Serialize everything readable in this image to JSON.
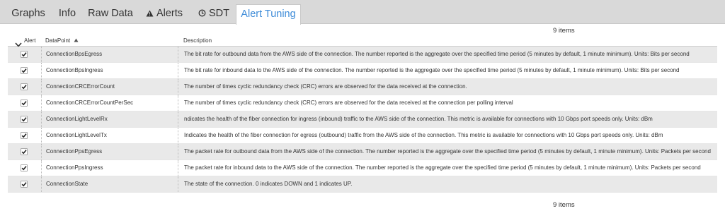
{
  "tabs": [
    {
      "label": "Graphs",
      "icon": ""
    },
    {
      "label": "Info",
      "icon": ""
    },
    {
      "label": "Raw Data",
      "icon": ""
    },
    {
      "label": "Alerts",
      "icon": "warning-icon"
    },
    {
      "label": "SDT",
      "icon": "sdt-clock-icon"
    },
    {
      "label": "Alert Tuning",
      "icon": ""
    }
  ],
  "active_tab": "Alert Tuning",
  "item_count_top": "9 items",
  "item_count_bottom": "9 items",
  "table": {
    "headers": {
      "alert": "Alert",
      "datapoint": "DataPoint",
      "description": "Description"
    },
    "sort": {
      "column": "DataPoint",
      "direction": "ascending"
    },
    "rows": [
      {
        "checked": true,
        "datapoint": "ConnectionBpsEgress",
        "description": "The bit rate for outbound data from the AWS side of the connection. The number reported is the aggregate over the specified time period (5 minutes by default, 1 minute minimum). Units: Bits per second"
      },
      {
        "checked": true,
        "datapoint": "ConnectionBpsIngress",
        "description": "The bit rate for inbound data to the AWS side of the connection. The number reported is the aggregate over the specified time period (5 minutes by default, 1 minute minimum). Units: Bits per second"
      },
      {
        "checked": true,
        "datapoint": "ConnectionCRCErrorCount",
        "description": "The number of times cyclic redundancy check (CRC) errors are observed for the data received at the connection."
      },
      {
        "checked": true,
        "datapoint": "ConnectionCRCErrorCountPerSec",
        "description": "The number of times cyclic redundancy check (CRC) errors are observed for the data received at the connection per polling interval"
      },
      {
        "checked": true,
        "datapoint": "ConnectionLightLevelRx",
        "description": "ndicates the health of the fiber connection for ingress (inbound) traffic to the AWS side of the connection. This metric is available for connections with 10 Gbps port speeds only. Units: dBm"
      },
      {
        "checked": true,
        "datapoint": "ConnectionLightLevelTx",
        "description": "Indicates the health of the fiber connection for egress (outbound) traffic from the AWS side of the connection. This metric is available for connections with 10 Gbps port speeds only. Units: dBm"
      },
      {
        "checked": true,
        "datapoint": "ConnectionPpsEgress",
        "description": "The packet rate for outbound data from the AWS side of the connection. The number reported is the aggregate over the specified time period (5 minutes by default, 1 minute minimum). Units: Packets per second"
      },
      {
        "checked": true,
        "datapoint": "ConnectionPpsIngress",
        "description": "The packet rate for inbound data to the AWS side of the connection. The number reported is the aggregate over the specified time period (5 minutes by default, 1 minute minimum). Units: Packets per second"
      },
      {
        "checked": true,
        "datapoint": "ConnectionState",
        "description": "The state of the connection. 0 indicates DOWN and 1 indicates UP."
      }
    ]
  },
  "colors": {
    "active_tab_text": "#3d8bd8",
    "tabbar_bg": "#d9d9d9",
    "odd_row_bg": "#e9e9e9"
  }
}
